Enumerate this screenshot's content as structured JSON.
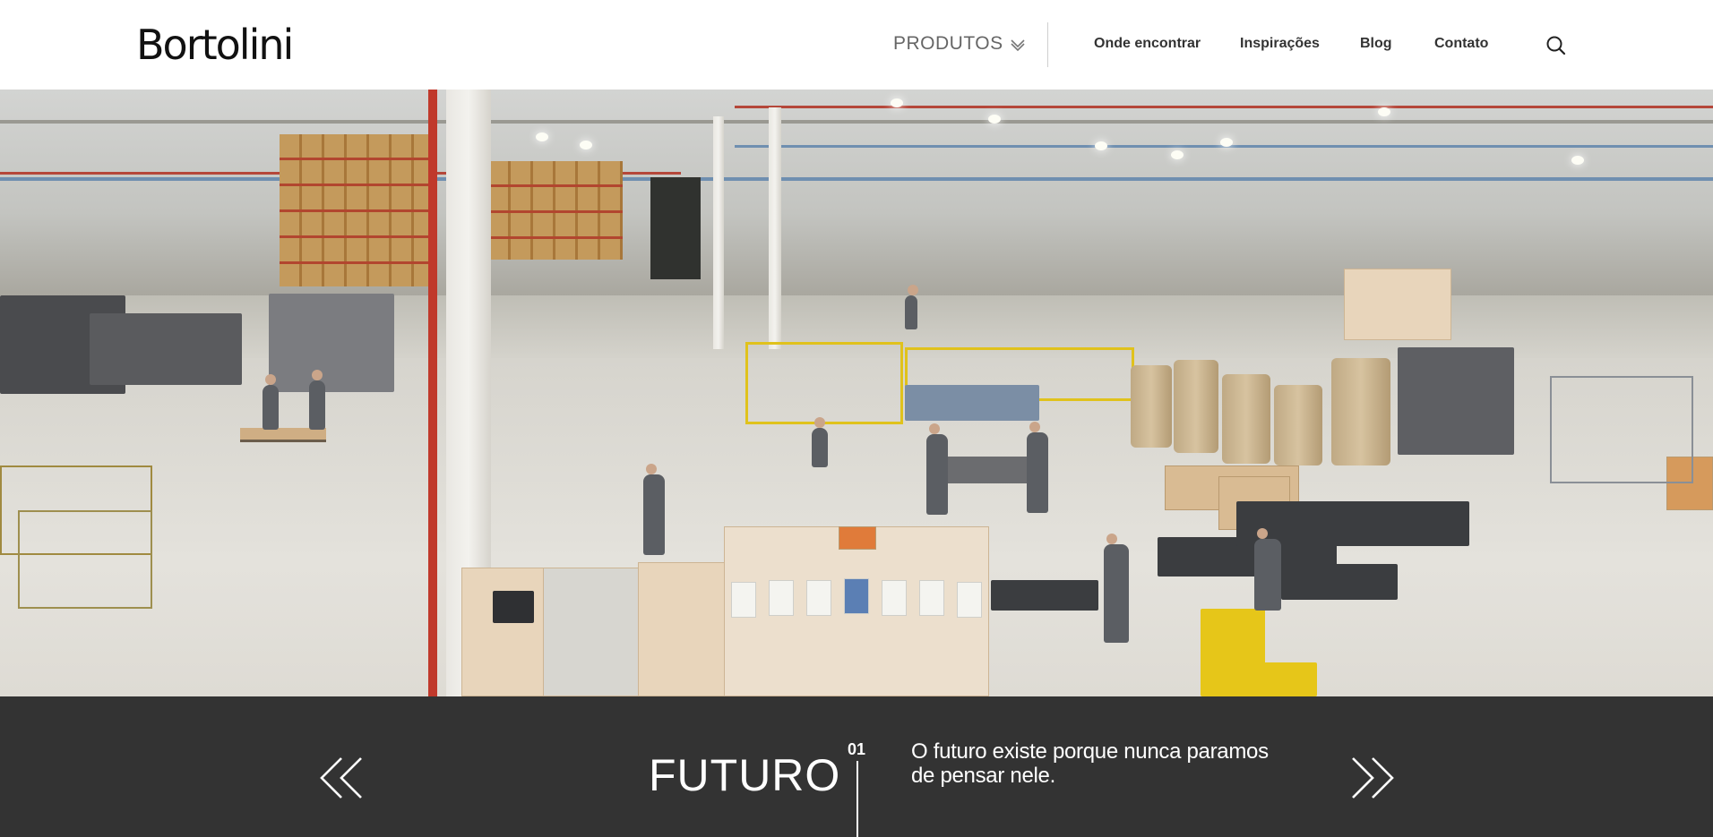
{
  "header": {
    "logo": "Bortolini",
    "nav": {
      "produtos_label": "PRODUTOS",
      "links": [
        "Onde encontrar",
        "Inspirações",
        "Blog",
        "Contato"
      ]
    },
    "icons": {
      "dropdown": "chevron-down-icon",
      "search": "search-icon"
    }
  },
  "hero": {
    "image": "factory-floor-photo"
  },
  "slider": {
    "prev_icon": "double-chevron-left-icon",
    "next_icon": "double-chevron-right-icon",
    "number": "01",
    "title": "FUTURO",
    "description": "O futuro existe porque nunca paramos de pensar nele."
  },
  "colors": {
    "slider_background": "#333333",
    "header_background": "#ffffff",
    "text_light": "#ffffff",
    "nav_text": "#333333"
  }
}
